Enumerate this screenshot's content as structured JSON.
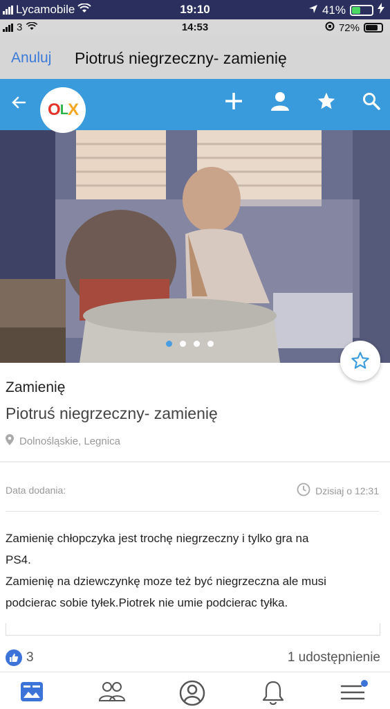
{
  "outer_status": {
    "carrier": "Lycamobile",
    "time": "19:10",
    "battery": "41%"
  },
  "inner_status": {
    "carrier": "3",
    "time": "14:53",
    "battery": "72%"
  },
  "share_header": {
    "cancel_label": "Anuluj",
    "title": "Piotruś niegrzeczny- zamienię"
  },
  "olx_bar": {
    "logo_o": "O",
    "logo_l": "L",
    "logo_x": "X"
  },
  "listing": {
    "category": "Zamienię",
    "title": "Piotruś niegrzeczny- zamienię",
    "location": "Dolnośląskie, Legnica",
    "date_label": "Data dodania:",
    "date_value": "Dzisiaj o 12:31",
    "description_lines": [
      "Zamienię chłopczyka jest trochę niegrzeczny i tylko gra na",
      "PS4.",
      "Zamienię na dziewczynkę moze też być niegrzeczna ale musi",
      "podcierac sobie tyłek.Piotrek nie umie podcierac tyłka."
    ]
  },
  "reactions": {
    "likes": "3",
    "shares": "1 udostępnienie"
  },
  "colors": {
    "olx_blue": "#3a9bdc",
    "facebook_blue": "#3b73d9",
    "ios_link": "#3b7ad9"
  }
}
